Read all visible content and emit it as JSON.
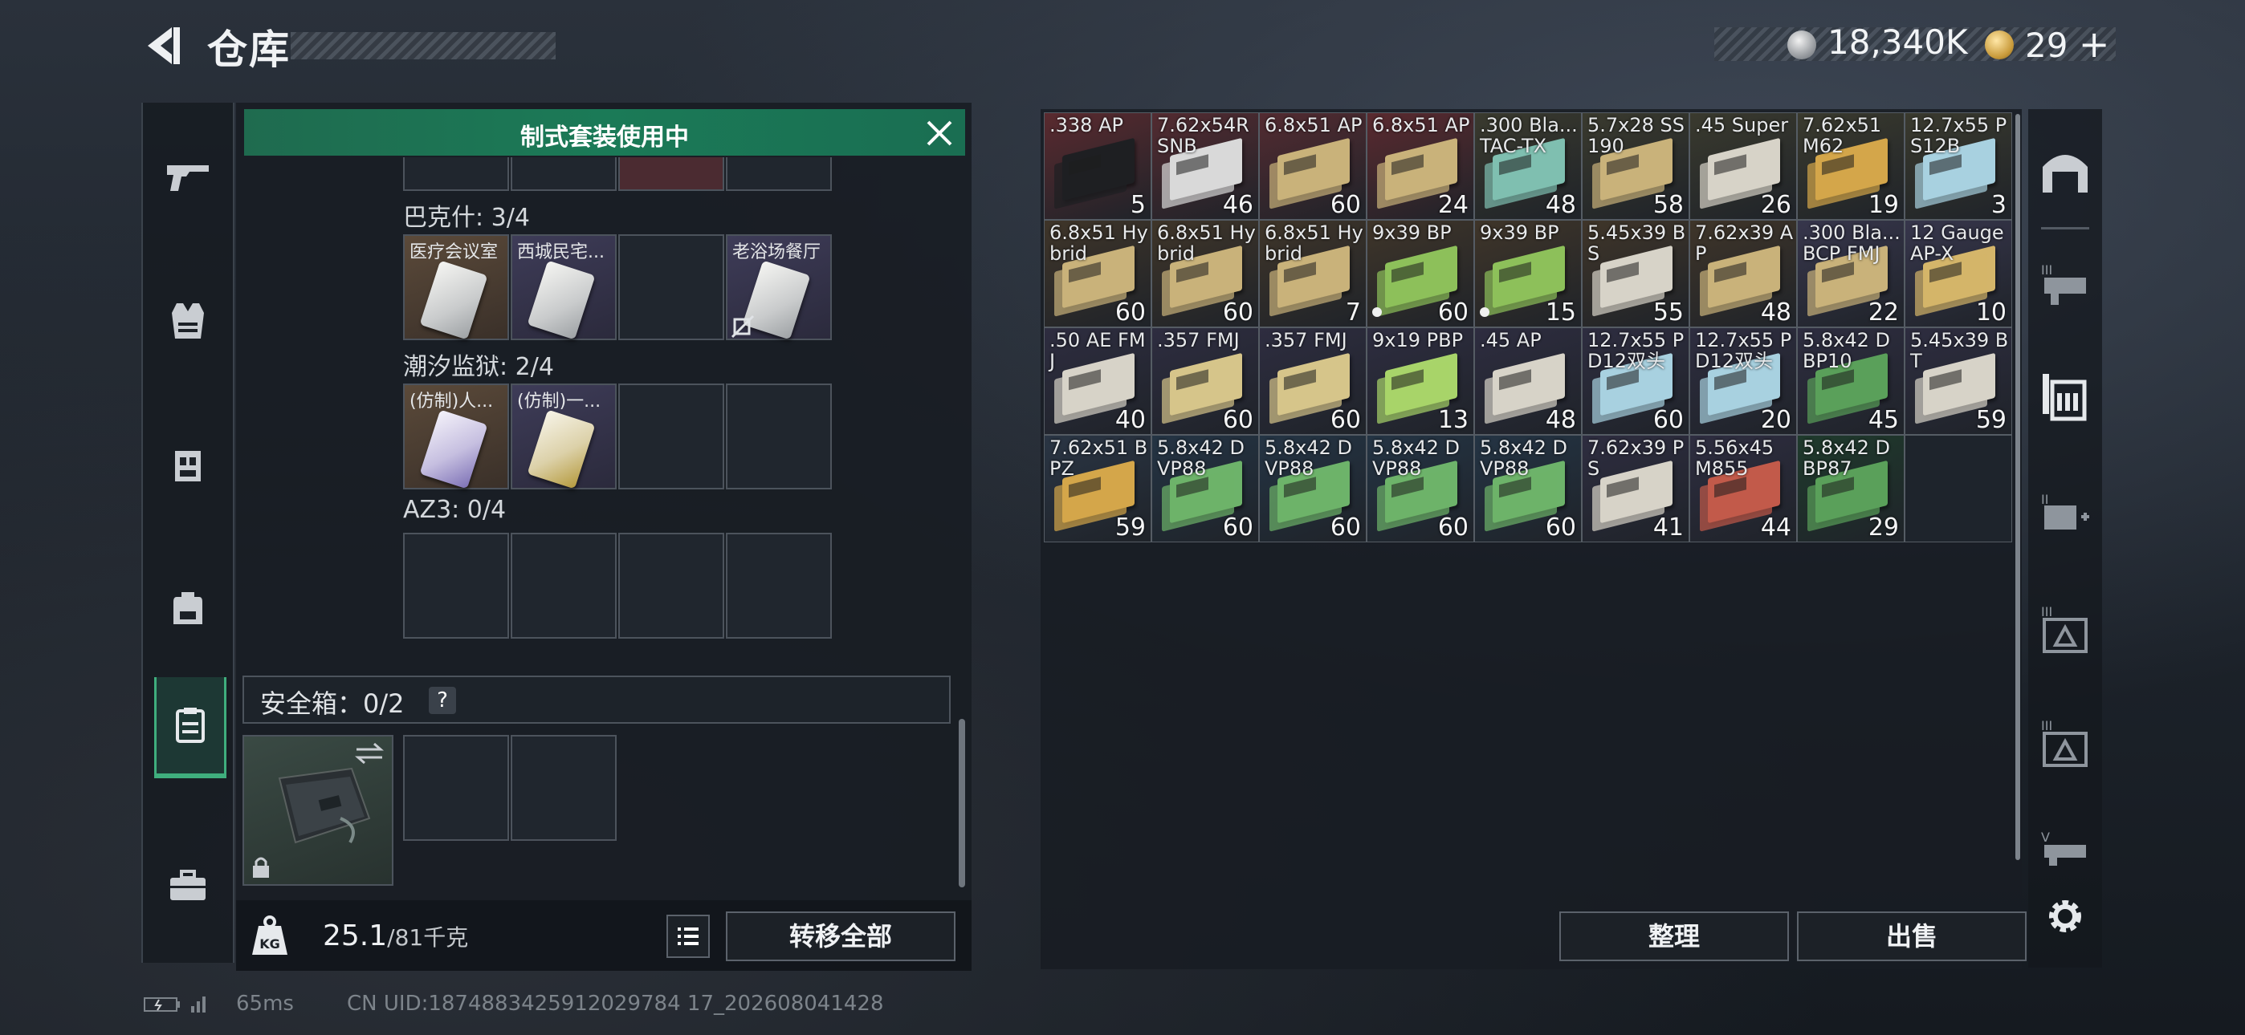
{
  "header": {
    "title": "仓库",
    "currency_value": "18,340K",
    "premium_value": "29",
    "premium_add_icon": "plus-icon"
  },
  "left_panel": {
    "banner_text": "制式套装使用中",
    "groups": [
      {
        "title": "巴克什: 3/4",
        "slots": [
          "医疗会议室",
          "西城民宅...",
          "",
          "老浴场餐厅"
        ]
      },
      {
        "title": "潮汐监狱: 2/4",
        "slots": [
          "(仿制)人...",
          "(仿制)一...",
          "",
          ""
        ]
      },
      {
        "title": "AZ3: 0/4",
        "slots": [
          "",
          "",
          "",
          ""
        ]
      }
    ],
    "safebox_label": "安全箱：0/2",
    "safebox_help": "?",
    "weight_value": "25.1",
    "weight_max": "/81千克",
    "transfer_all": "转移全部"
  },
  "ammo": [
    {
      "name": ".338 AP",
      "count": "5"
    },
    {
      "name": "7.62x54R SNB",
      "count": "46"
    },
    {
      "name": "6.8x51 AP",
      "count": "60"
    },
    {
      "name": "6.8x51 AP",
      "count": "24"
    },
    {
      "name": ".300 Bla... TAC-TX",
      "count": "48"
    },
    {
      "name": "5.7x28 SS190",
      "count": "58"
    },
    {
      "name": ".45 Super",
      "count": "26"
    },
    {
      "name": "7.62x51 M62",
      "count": "19"
    },
    {
      "name": "12.7x55 PS12B",
      "count": "3"
    },
    {
      "name": "6.8x51 Hybrid",
      "count": "60"
    },
    {
      "name": "6.8x51 Hybrid",
      "count": "60"
    },
    {
      "name": "6.8x51 Hybrid",
      "count": "7"
    },
    {
      "name": "9x39 BP",
      "count": "60"
    },
    {
      "name": "9x39 BP",
      "count": "15"
    },
    {
      "name": "5.45x39 BS",
      "count": "55"
    },
    {
      "name": "7.62x39 AP",
      "count": "48"
    },
    {
      "name": ".300 Bla... BCP FMJ",
      "count": "22"
    },
    {
      "name": "12 Gauge AP-X",
      "count": "10"
    },
    {
      "name": ".50 AE FMJ",
      "count": "40"
    },
    {
      "name": ".357 FMJ",
      "count": "60"
    },
    {
      "name": ".357 FMJ",
      "count": "60"
    },
    {
      "name": "9x19 PBP",
      "count": "13"
    },
    {
      "name": ".45 AP",
      "count": "48"
    },
    {
      "name": "12.7x55 PD12双头",
      "count": "60"
    },
    {
      "name": "12.7x55 PD12双头",
      "count": "20"
    },
    {
      "name": "5.8x42 DBP10",
      "count": "45"
    },
    {
      "name": "5.45x39 BT",
      "count": "59"
    },
    {
      "name": "7.62x51 BPZ",
      "count": "59"
    },
    {
      "name": "5.8x42 DVP88",
      "count": "60"
    },
    {
      "name": "5.8x42 DVP88",
      "count": "60"
    },
    {
      "name": "5.8x42 DVP88",
      "count": "60"
    },
    {
      "name": "5.8x42 DVP88",
      "count": "60"
    },
    {
      "name": "7.62x39 PS",
      "count": "41"
    },
    {
      "name": "5.56x45 M855",
      "count": "44"
    },
    {
      "name": "5.8x42 DBP87",
      "count": "29"
    }
  ],
  "buttons": {
    "sort": "整理",
    "sell": "出售"
  },
  "status": {
    "ping": "65ms",
    "uid": "CN UID:1874883425912029784 17_202608041428"
  },
  "colors": {
    "accent_green": "#1b7a57",
    "active_tab": "#3fae7d"
  }
}
